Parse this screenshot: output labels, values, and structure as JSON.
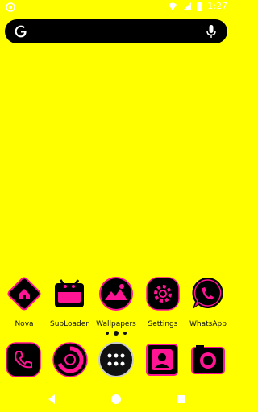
{
  "status_bar": {
    "time": "1:27",
    "icons": [
      "notification-circle-icon",
      "wifi-icon",
      "signal-icon",
      "battery-icon"
    ]
  },
  "search_bar": {
    "logo": "google-g-icon",
    "mic": "microphone-icon",
    "color": "#000000"
  },
  "home_apps": [
    {
      "label": "Nova",
      "icon": "nova-icon"
    },
    {
      "label": "SubLoader",
      "icon": "subloader-icon"
    },
    {
      "label": "Wallpapers",
      "icon": "wallpapers-icon"
    },
    {
      "label": "Settings",
      "icon": "settings-gear-icon"
    },
    {
      "label": "WhatsApp",
      "icon": "whatsapp-icon"
    }
  ],
  "page_indicator": {
    "count": 3,
    "active_index": 1
  },
  "dock": [
    {
      "icon": "phone-icon"
    },
    {
      "icon": "browser-icon"
    },
    {
      "icon": "app-drawer-icon"
    },
    {
      "icon": "contacts-icon"
    },
    {
      "icon": "camera-icon"
    }
  ],
  "nav_bar": {
    "buttons": [
      "back-icon",
      "home-icon",
      "recents-icon"
    ]
  },
  "colors": {
    "background": "#ffff00",
    "accent": "#ff1493",
    "icon_base": "#000000"
  }
}
